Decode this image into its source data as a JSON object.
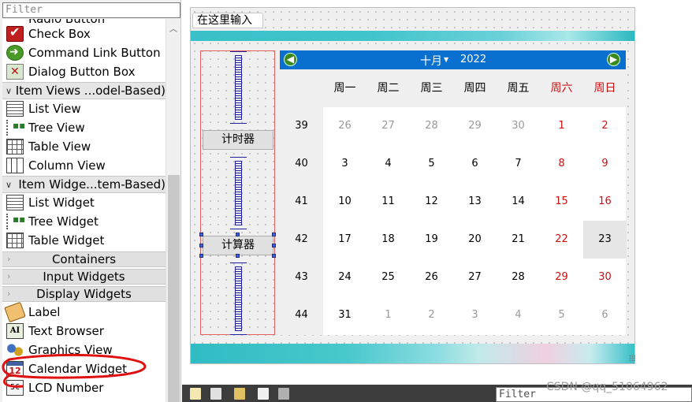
{
  "widget_box": {
    "filter_placeholder": "Filter",
    "partial_top_item": "Radio Button",
    "items": [
      {
        "label": "Check Box",
        "icon": "checkbox-icon"
      },
      {
        "label": "Command Link Button",
        "icon": "command-link-icon"
      },
      {
        "label": "Dialog Button Box",
        "icon": "dialog-button-box-icon"
      }
    ],
    "category_item_views": "Item Views ...odel-Based)",
    "item_views": [
      {
        "label": "List View",
        "icon": "list-view-icon"
      },
      {
        "label": "Tree View",
        "icon": "tree-view-icon"
      },
      {
        "label": "Table View",
        "icon": "table-view-icon"
      },
      {
        "label": "Column View",
        "icon": "column-view-icon"
      }
    ],
    "category_item_widgets": "Item Widge...tem-Based)",
    "item_widgets": [
      {
        "label": "List Widget",
        "icon": "list-widget-icon"
      },
      {
        "label": "Tree Widget",
        "icon": "tree-widget-icon"
      },
      {
        "label": "Table Widget",
        "icon": "table-widget-icon"
      }
    ],
    "category_containers": "Containers",
    "category_input": "Input Widgets",
    "category_display": "Display Widgets",
    "display_widgets": [
      {
        "label": "Label",
        "icon": "label-icon"
      },
      {
        "label": "Text Browser",
        "icon": "text-browser-icon"
      },
      {
        "label": "Graphics View",
        "icon": "graphics-view-icon"
      },
      {
        "label": "Calendar Widget",
        "icon": "calendar-widget-icon"
      },
      {
        "label": "LCD Number",
        "icon": "lcd-number-icon"
      }
    ],
    "annotation_color": "#e01010"
  },
  "form": {
    "line_edit_text": "在这里输入",
    "buttons": {
      "timer": "计时器",
      "calculator": "计算器"
    }
  },
  "calendar": {
    "month": "十月",
    "year": "2022",
    "weekday_headers": [
      "周一",
      "周二",
      "周三",
      "周四",
      "周五",
      "周六",
      "周日"
    ],
    "weeks": [
      {
        "week": "39",
        "days": [
          "26",
          "27",
          "28",
          "29",
          "30",
          "1",
          "2"
        ]
      },
      {
        "week": "40",
        "days": [
          "3",
          "4",
          "5",
          "6",
          "7",
          "8",
          "9"
        ]
      },
      {
        "week": "41",
        "days": [
          "10",
          "11",
          "12",
          "13",
          "14",
          "15",
          "16"
        ]
      },
      {
        "week": "42",
        "days": [
          "17",
          "18",
          "19",
          "20",
          "21",
          "22",
          "23"
        ]
      },
      {
        "week": "43",
        "days": [
          "24",
          "25",
          "26",
          "27",
          "28",
          "29",
          "30"
        ]
      },
      {
        "week": "44",
        "days": [
          "31",
          "1",
          "2",
          "3",
          "4",
          "5",
          "6"
        ]
      }
    ],
    "selected_date": "23",
    "header_color": "#0a70d0",
    "weekend_color": "#d01010"
  },
  "bottom": {
    "filter_placeholder": "Filter",
    "watermark": "CSDN @qq_51064962"
  }
}
